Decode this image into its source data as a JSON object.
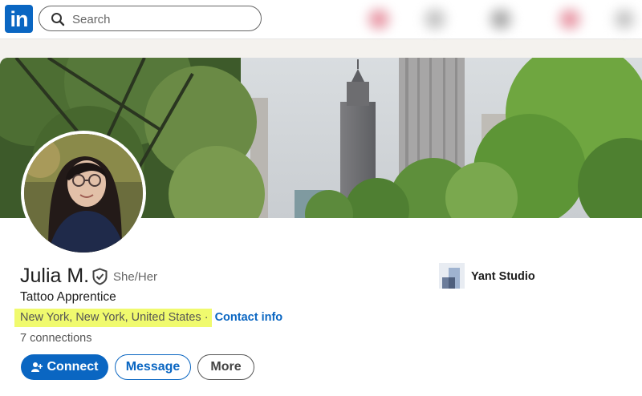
{
  "nav": {
    "logo_text": "in",
    "search_placeholder": "Search"
  },
  "profile": {
    "name": "Julia M.",
    "pronouns": "She/Her",
    "headline": "Tattoo Apprentice",
    "location": "New York, New York, United States",
    "separator": "·",
    "contact_info": "Contact info",
    "connections": "7 connections",
    "company": "Yant Studio",
    "highlight_color": "#f0fa6e"
  },
  "actions": {
    "connect": "Connect",
    "message": "Message",
    "more": "More"
  },
  "colors": {
    "brand": "#0a66c2",
    "page_bg": "#f4f2ee"
  }
}
